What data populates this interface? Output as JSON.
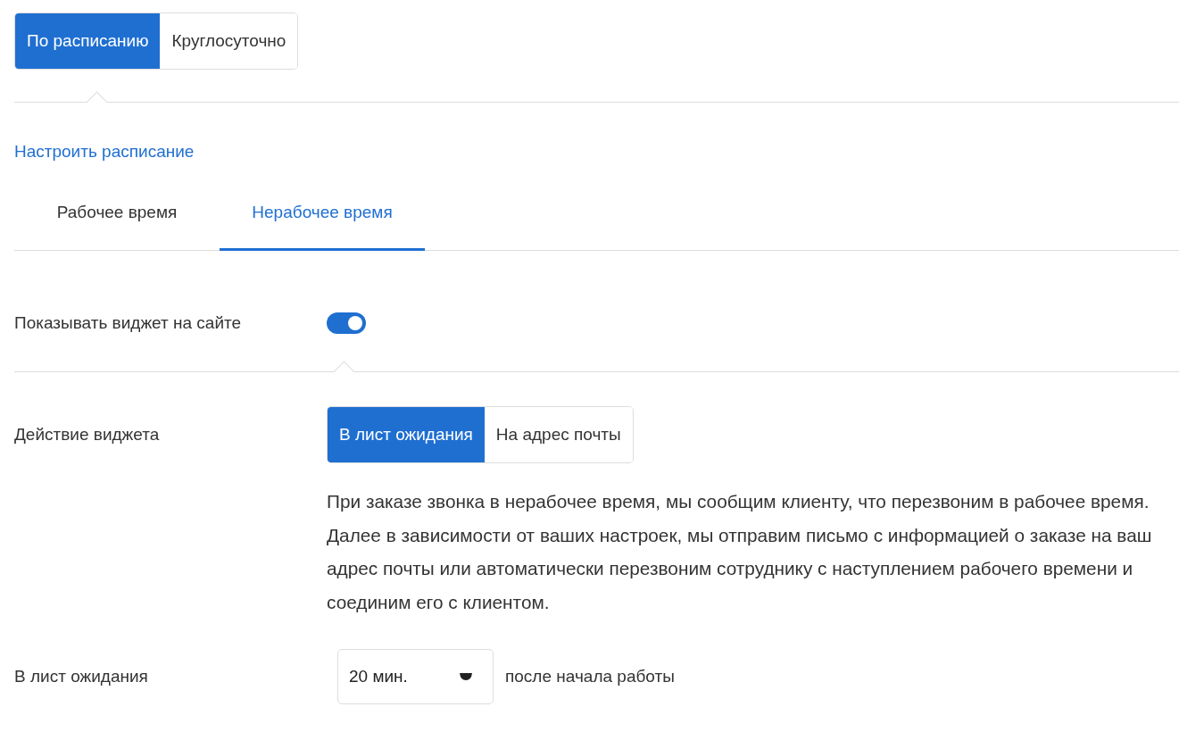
{
  "schedule_modes": [
    {
      "label": "По расписанию",
      "selected": true
    },
    {
      "label": "Круглосуточно",
      "selected": false
    }
  ],
  "schedule_link": "Настроить расписание",
  "tabs": [
    {
      "label": "Рабочее время",
      "selected": false
    },
    {
      "label": "Нерабочее время",
      "selected": true
    }
  ],
  "show_widget": {
    "label": "Показывать виджет на сайте",
    "on": true
  },
  "widget_action": {
    "label": "Действие виджета",
    "options": [
      {
        "label": "В лист ожидания",
        "selected": true
      },
      {
        "label": "На адрес почты",
        "selected": false
      }
    ],
    "description": "При заказе звонка в нерабочее время, мы сообщим клиенту, что перезвоним в рабочее время. Далее в зависимости от ваших настроек, мы отправим письмо с информацией о заказе на ваш адрес почты или автоматически перезвоним сотруднику с наступлением рабочего времени и соединим его с клиентом."
  },
  "waiting_list": {
    "label": "В лист ожидания",
    "delay": "20 мин.",
    "suffix": "после начала работы"
  }
}
